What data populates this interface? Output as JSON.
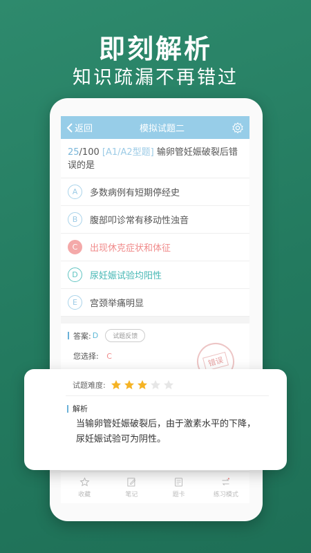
{
  "promo": {
    "title": "即刻解析",
    "subtitle": "知识疏漏不再错过"
  },
  "navbar": {
    "back_label": "返回",
    "title": "模拟试题二"
  },
  "question": {
    "current": "25",
    "total": "/100",
    "tag": "[A1/A2型题]",
    "text": "输卵管妊娠破裂后错误的是"
  },
  "options": [
    {
      "letter": "A",
      "text": "多数病例有短期停经史",
      "state": "normal"
    },
    {
      "letter": "B",
      "text": "腹部叩诊常有移动性浊音",
      "state": "normal"
    },
    {
      "letter": "C",
      "text": "出现休克症状和体征",
      "state": "wrong"
    },
    {
      "letter": "D",
      "text": "尿妊娠试验均阳性",
      "state": "correct"
    },
    {
      "letter": "E",
      "text": "宫颈举痛明显",
      "state": "normal"
    }
  ],
  "answer": {
    "label": "答案:",
    "value": "D",
    "feedback_label": "试题反馈",
    "your_choice_label": "您选择:",
    "your_choice_value": "C",
    "stamp_text": "错误"
  },
  "difficulty": {
    "label": "试题难度:",
    "rating": 3,
    "max": 5,
    "star_on_color": "#f5b324",
    "star_off_color": "#e6e6e6"
  },
  "analysis": {
    "label": "解析",
    "text_line1": "当输卵管妊娠破裂后，由于激素水平的下降，",
    "text_line2": "尿妊娠试验可为阴性。"
  },
  "tabbar": {
    "items": [
      {
        "label": "收藏",
        "icon": "star-outline-icon"
      },
      {
        "label": "笔记",
        "icon": "edit-icon"
      },
      {
        "label": "题卡",
        "icon": "card-icon"
      },
      {
        "label": "练习模式",
        "icon": "mode-icon"
      }
    ]
  },
  "colors": {
    "background": "#2e8a6d",
    "navbar": "#97cde8",
    "wrong": "#f08a8a",
    "correct": "#45b7b4"
  }
}
